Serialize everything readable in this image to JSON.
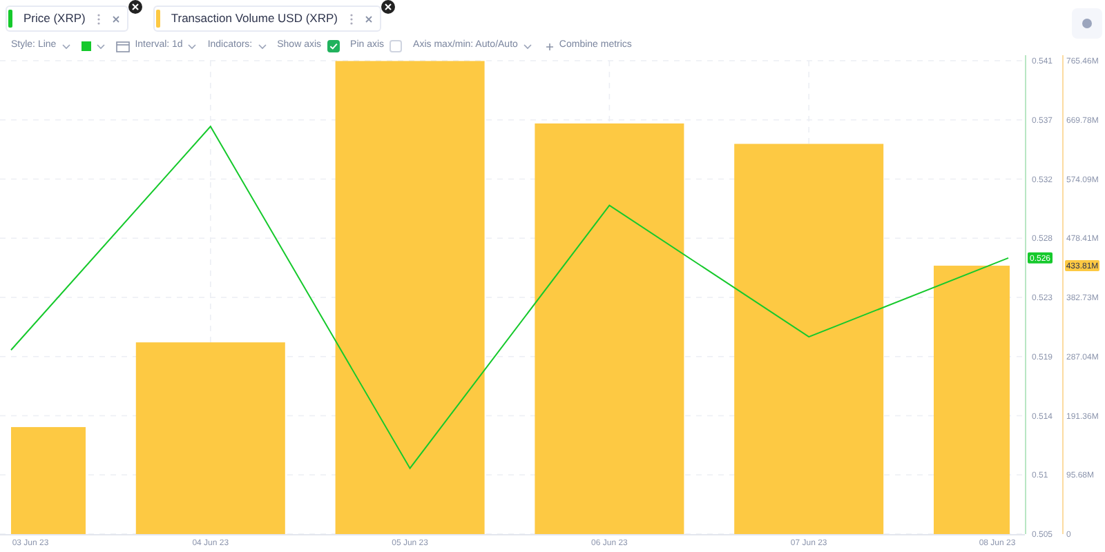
{
  "toolbar": {
    "style": "Style: Line",
    "color": "#16c92c",
    "interval": "Interval: 1d",
    "indicators": "Indicators:",
    "show_axis": {
      "label": "Show axis",
      "checked": true
    },
    "pin_axis": {
      "label": "Pin axis",
      "checked": false
    },
    "axis_minmax": "Axis max/min: Auto/Auto",
    "combine": "Combine metrics"
  },
  "chart": {
    "chart_data": {
      "type": "bar",
      "grid": true,
      "categories": [
        "03 Jun 23",
        "04 Jun 23",
        "05 Jun 23",
        "06 Jun 23",
        "07 Jun 23",
        "08 Jun 23"
      ],
      "series": [
        {
          "name": "Price (XRP)",
          "type": "line",
          "axis": "y2",
          "color": "#16c92c",
          "values": [
            0.519,
            0.536,
            0.51,
            0.53,
            0.52,
            0.526
          ]
        },
        {
          "name": "Transaction Volume USD (XRP)",
          "color": "#fdc943",
          "values": [
            173,
            310,
            765,
            664,
            631,
            434
          ]
        }
      ],
      "ylim": [
        0,
        765.46
      ],
      "yticks": [
        {
          "value": 765.46,
          "label": "765.46M"
        },
        {
          "value": 669.78,
          "label": "669.78M"
        },
        {
          "value": 574.09,
          "label": "574.09M"
        },
        {
          "value": 478.41,
          "label": "478.41M"
        },
        {
          "value": 382.73,
          "label": "382.73M"
        },
        {
          "value": 287.04,
          "label": "287.04M"
        },
        {
          "value": 191.36,
          "label": "191.36M"
        },
        {
          "value": 95.68,
          "label": "95.68M"
        },
        {
          "value": 0,
          "label": "0"
        }
      ],
      "y2lim": [
        0.505,
        0.541
      ],
      "y2ticks": [
        {
          "value": 0.541,
          "label": "0.541"
        },
        {
          "value": 0.5365,
          "label": "0.537"
        },
        {
          "value": 0.532,
          "label": "0.532"
        },
        {
          "value": 0.5275,
          "label": "0.528"
        },
        {
          "value": 0.523,
          "label": "0.523"
        },
        {
          "value": 0.5185,
          "label": "0.519"
        },
        {
          "value": 0.514,
          "label": "0.514"
        },
        {
          "value": 0.5095,
          "label": "0.51"
        },
        {
          "value": 0.505,
          "label": "0.505"
        }
      ]
    },
    "price_badge": "0.526",
    "volume_badge": "433.81M"
  }
}
